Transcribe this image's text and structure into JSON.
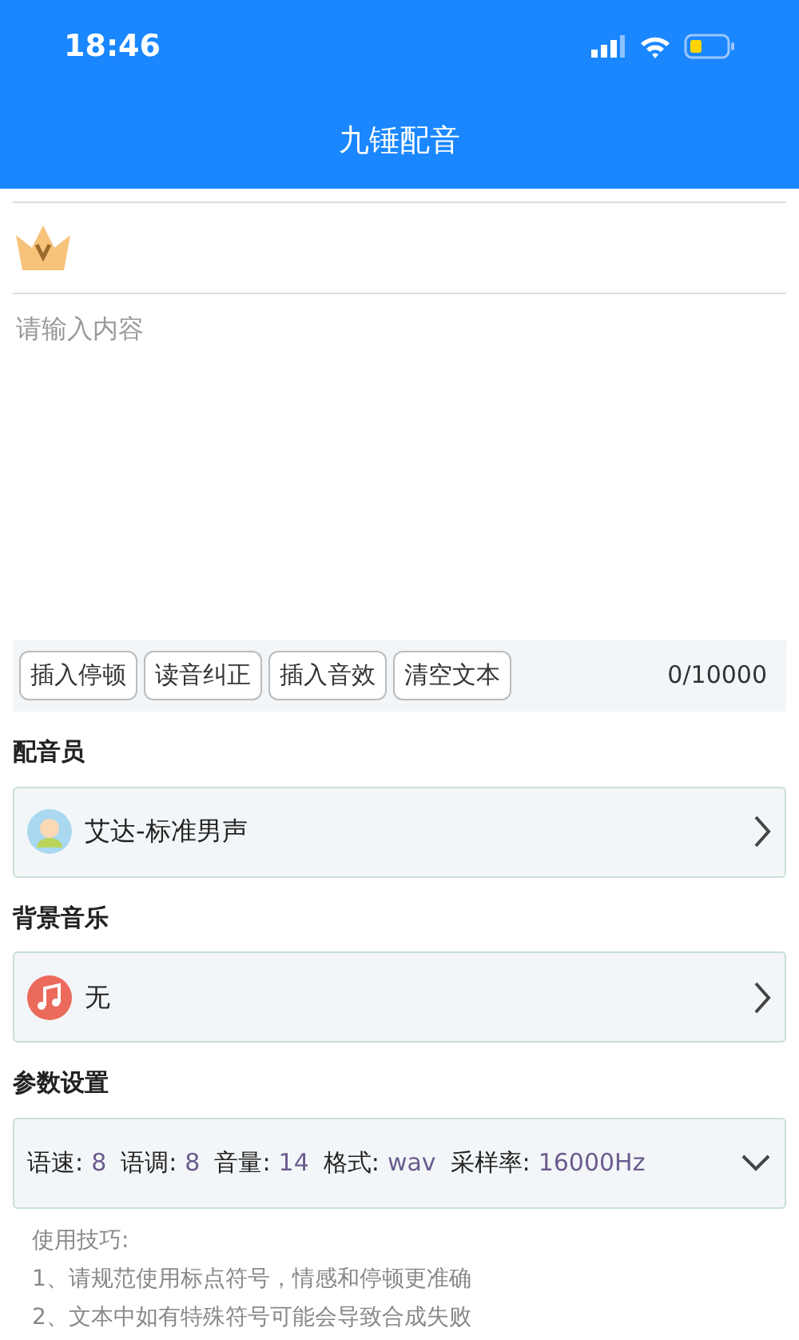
{
  "status_bar": {
    "time": "18:46"
  },
  "header": {
    "title": "九锤配音"
  },
  "editor": {
    "placeholder": "请输入内容"
  },
  "toolbar": {
    "buttons": [
      "插入停顿",
      "读音纠正",
      "插入音效",
      "清空文本"
    ],
    "counter": "0/10000"
  },
  "voice": {
    "label": "配音员",
    "value": "艾达-标准男声"
  },
  "music": {
    "label": "背景音乐",
    "value": "无"
  },
  "params": {
    "label": "参数设置",
    "items": [
      {
        "name": "语速:",
        "value": "8"
      },
      {
        "name": "语调:",
        "value": "8"
      },
      {
        "name": "音量:",
        "value": "14"
      },
      {
        "name": "格式:",
        "value": "wav"
      },
      {
        "name": "采样率:",
        "value": "16000Hz"
      }
    ]
  },
  "tips": [
    "使用技巧:",
    "1、请规范使用标点符号，情感和停顿更准确",
    "2、文本中如有特殊符号可能会导致合成失败"
  ]
}
